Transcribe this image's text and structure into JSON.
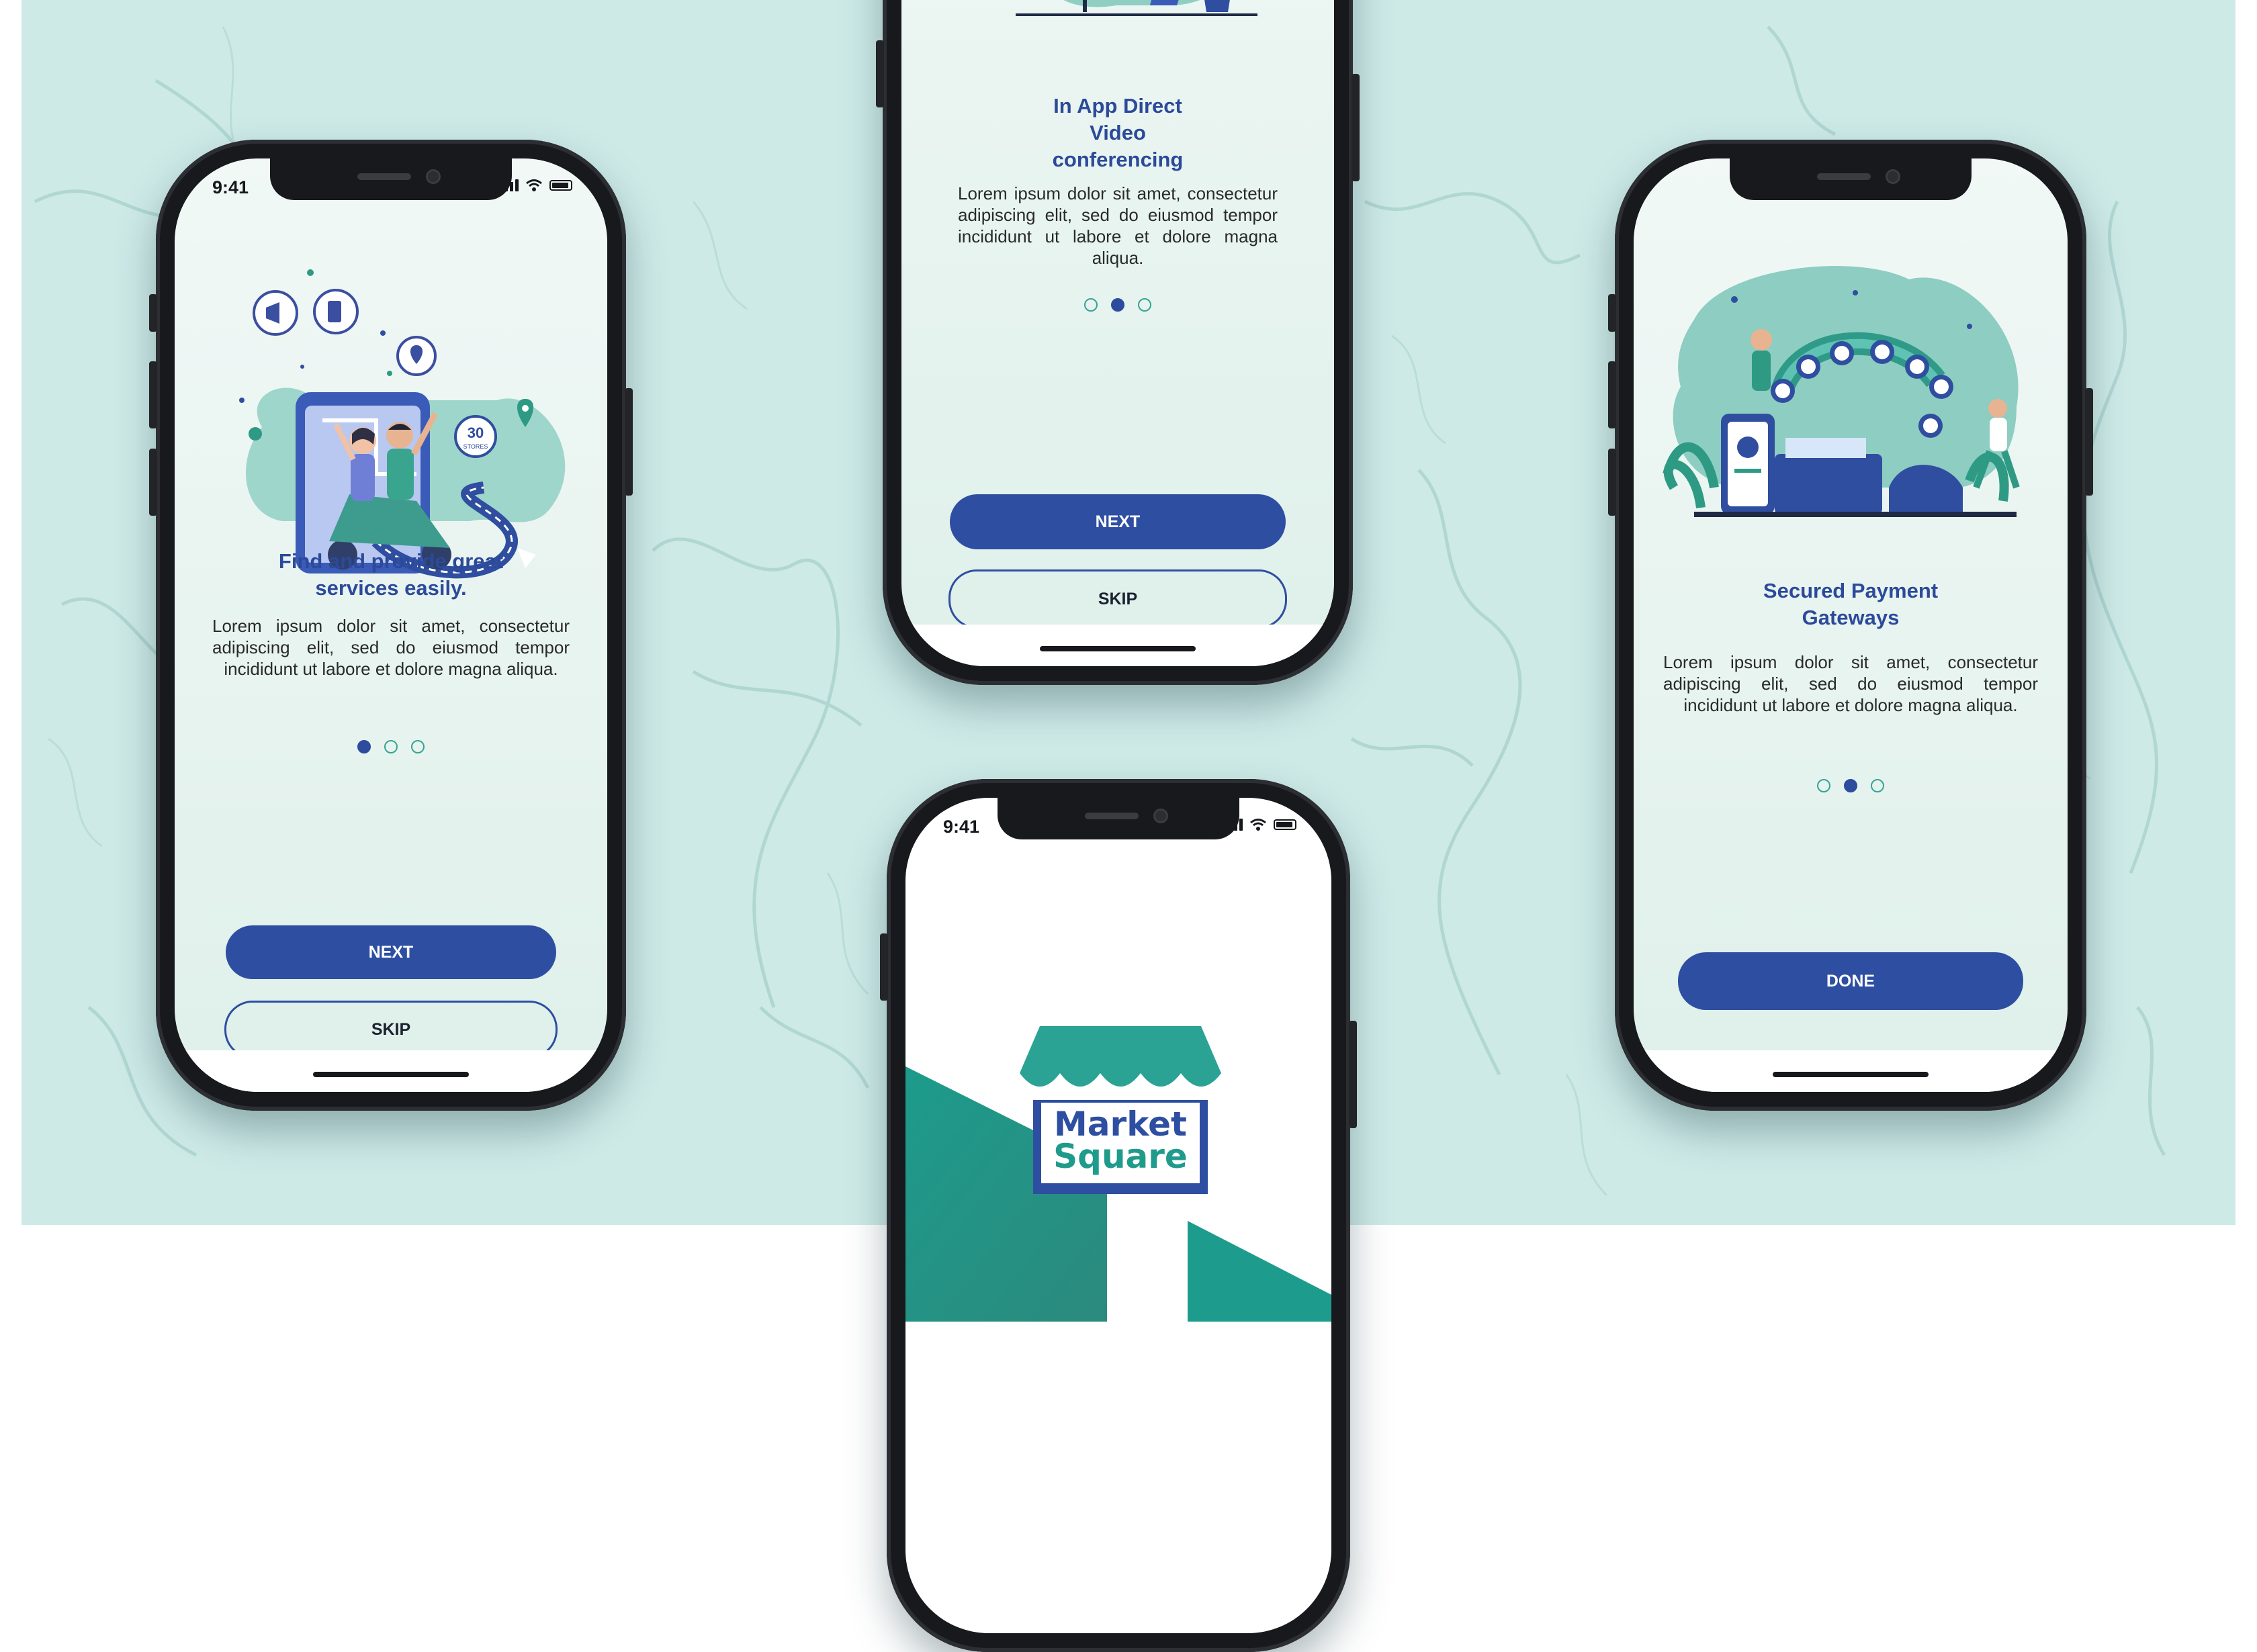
{
  "status": {
    "time": "9:41"
  },
  "screen1": {
    "title": "Find and provide great services easily.",
    "body": "Lorem ipsum dolor sit amet, consectetur adipiscing elit, sed do eiusmod tempor incididunt ut labore et dolore magna aliqua.",
    "illustration_badge": "30",
    "illustration_badge_sub": "STORES",
    "next_label": "NEXT",
    "skip_label": "SKIP",
    "active_dot": 1
  },
  "screen2": {
    "title": "In App Direct Video conferencing",
    "body": "Lorem ipsum dolor sit amet, consectetur adipiscing elit, sed do eiusmod tempor incididunt ut labore et dolore magna aliqua.",
    "next_label": "NEXT",
    "skip_label": "SKIP",
    "active_dot": 2
  },
  "screen3": {
    "time": "9:41",
    "logo_line1": "Market",
    "logo_line2": "Square"
  },
  "screen4": {
    "title": "Secured Payment Gateways",
    "body": "Lorem ipsum dolor sit amet, consectetur adipiscing elit, sed do eiusmod tempor incididunt ut labore et dolore magna aliqua.",
    "done_label": "DONE",
    "active_dot": 2
  },
  "colors": {
    "brand_blue": "#2e4ea2",
    "teal": "#36a494",
    "background": "#cdeae7"
  }
}
